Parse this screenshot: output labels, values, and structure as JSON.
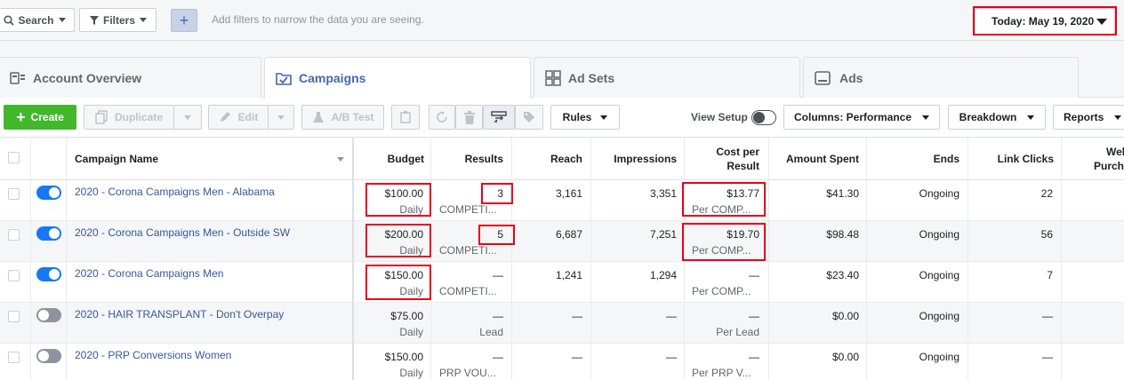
{
  "top_bar": {
    "search_label": "Search",
    "filters_label": "Filters",
    "add_label": "+",
    "placeholder": "Add filters to narrow the data you are seeing.",
    "date_label": "Today: May 19, 2020"
  },
  "tabs": [
    {
      "label": "Account Overview"
    },
    {
      "label": "Campaigns"
    },
    {
      "label": "Ad Sets"
    },
    {
      "label": "Ads"
    }
  ],
  "toolbar": {
    "create": "Create",
    "duplicate": "Duplicate",
    "edit": "Edit",
    "ab_test": "A/B Test",
    "rules": "Rules",
    "view_setup": "View Setup",
    "columns": "Columns: Performance",
    "breakdown": "Breakdown",
    "reports": "Reports"
  },
  "table": {
    "headers": {
      "name": "Campaign Name",
      "budget": "Budget",
      "results": "Results",
      "reach": "Reach",
      "impressions": "Impressions",
      "cost_line1": "Cost per",
      "cost_line2": "Result",
      "amount": "Amount Spent",
      "ends": "Ends",
      "link_clicks": "Link Clicks",
      "web_line1": "Wel",
      "web_line2": "Purch"
    },
    "rows": [
      {
        "on": true,
        "name": "2020 - Corona Campaigns Men - Alabama",
        "budget": "$100.00",
        "budget_sub": "Daily",
        "results": "3",
        "results_sub": "COMPETI...",
        "reach": "3,161",
        "impressions": "3,351",
        "cost": "$13.77",
        "cost_sub": "Per COMP...",
        "amount": "$41.30",
        "ends": "Ongoing",
        "link_clicks": "22"
      },
      {
        "on": true,
        "name": "2020 - Corona Campaigns Men - Outside SW",
        "budget": "$200.00",
        "budget_sub": "Daily",
        "results": "5",
        "results_sub": "COMPETI...",
        "reach": "6,687",
        "impressions": "7,251",
        "cost": "$19.70",
        "cost_sub": "Per COMP...",
        "amount": "$98.48",
        "ends": "Ongoing",
        "link_clicks": "56"
      },
      {
        "on": true,
        "name": "2020 - Corona Campaigns Men",
        "budget": "$150.00",
        "budget_sub": "Daily",
        "results": "—",
        "results_sub": "COMPETI...",
        "reach": "1,241",
        "impressions": "1,294",
        "cost": "—",
        "cost_sub": "Per COMP...",
        "amount": "$23.40",
        "ends": "Ongoing",
        "link_clicks": "7"
      },
      {
        "on": false,
        "name": "2020 - HAIR TRANSPLANT - Don't Overpay",
        "budget": "$75.00",
        "budget_sub": "Daily",
        "results": "—",
        "results_sub": "Lead",
        "reach": "—",
        "impressions": "—",
        "cost": "—",
        "cost_sub": "Per Lead",
        "amount": "$0.00",
        "ends": "Ongoing",
        "link_clicks": "—"
      },
      {
        "on": false,
        "name": "2020 - PRP Conversions Women",
        "budget": "$150.00",
        "budget_sub": "Daily",
        "results": "—",
        "results_sub": "PRP VOU...",
        "reach": "—",
        "impressions": "—",
        "cost": "—",
        "cost_sub": "Per PRP V...",
        "amount": "$0.00",
        "ends": "Ongoing",
        "link_clicks": "—"
      }
    ]
  },
  "colors": {
    "accent": "#4267b2",
    "create_green": "#42b72a",
    "highlight_red": "#e8001a",
    "toggle_on": "#1877f2"
  }
}
